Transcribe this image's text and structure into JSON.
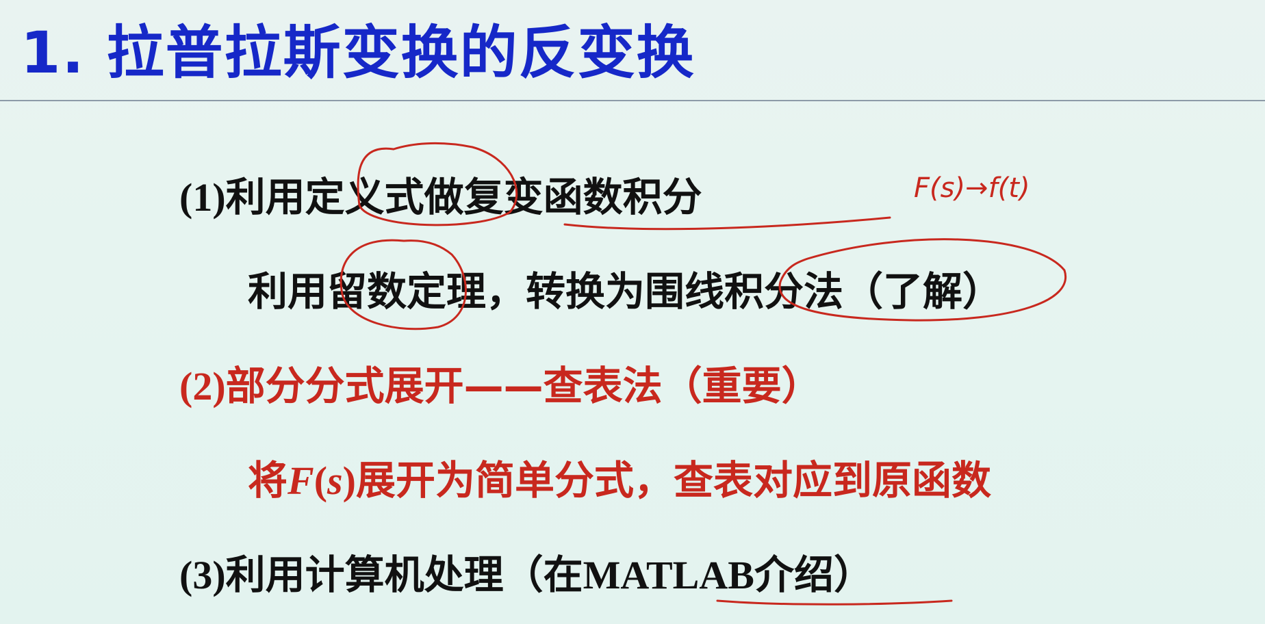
{
  "slide": {
    "title": "1. 拉普拉斯变换的反变换",
    "items": [
      {
        "number": "(1)",
        "text": "利用定义式做复变函数积分"
      },
      {
        "text": "利用留数定理，转换为围线积分法（了解）"
      },
      {
        "number": "(2)",
        "text": "部分分式展开——查表法（重要）"
      },
      {
        "prefix": "将",
        "math": "F",
        "paren_open": "(",
        "math_arg": "s",
        "paren_close": ")",
        "text": "展开为简单分式，查表对应到原函数"
      },
      {
        "number": "(3)",
        "text_before": "利用计算机处理（在",
        "latin": "MATLAB",
        "text_after": "介绍）"
      }
    ]
  },
  "annotations": {
    "handwritten_note": "F(s)→f(t)"
  },
  "colors": {
    "title": "#1628c8",
    "body_text": "#111111",
    "emphasis": "#c8281e",
    "ink": "#c8281e"
  }
}
